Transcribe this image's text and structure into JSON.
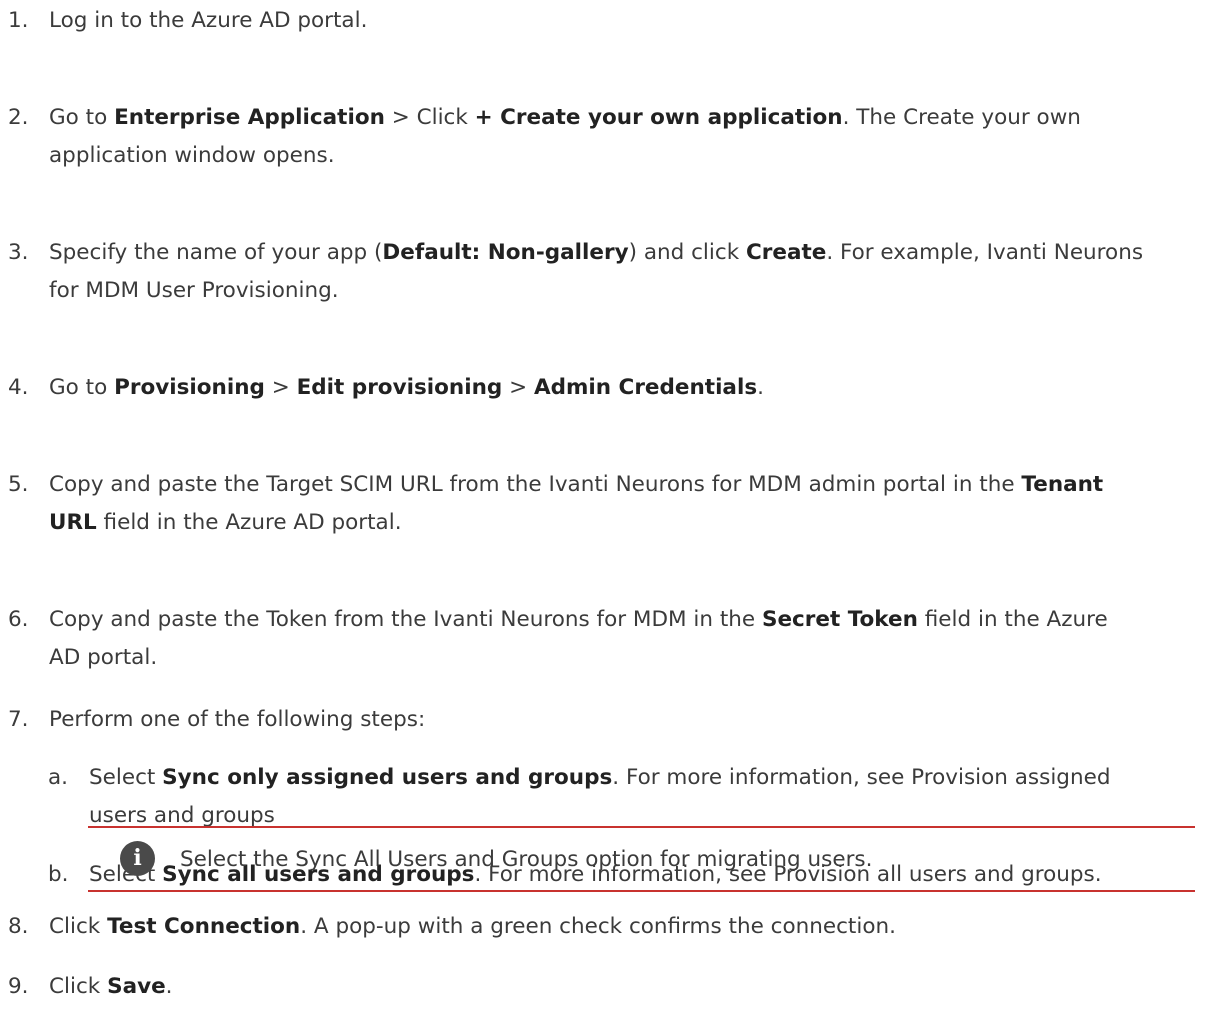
{
  "steps": [
    {
      "num": "1.",
      "text": "Log in to the Azure AD portal."
    },
    {
      "num": "2.",
      "t1": "Go to ",
      "b1": "Enterprise Application",
      "t2": " > Click ",
      "b2": "+ Create your own application",
      "t3": ". The Create your own",
      "line2": "application window opens."
    },
    {
      "num": "3.",
      "t1": "Specify the name of your app (",
      "b1": "Default: Non-gallery",
      "t2": ") and click ",
      "b2": "Create",
      "t3": ". For example, Ivanti Neurons",
      "line2": "for MDM User Provisioning."
    },
    {
      "num": "4.",
      "t1": "Go to ",
      "b1": "Provisioning",
      "t2": " > ",
      "b2": "Edit provisioning",
      "t3": " > ",
      "b3": "Admin Credentials",
      "t4": "."
    },
    {
      "num": "5.",
      "t1": "Copy and paste the Target SCIM URL from the Ivanti Neurons for MDM admin portal in the ",
      "b1": "Tenant",
      "b2": "URL",
      "t2": " field in the Azure AD portal."
    },
    {
      "num": "6.",
      "t1": "Copy and paste the Token from the Ivanti Neurons for MDM in the ",
      "b1": "Secret Token",
      "t2": " field in the Azure",
      "line2": "AD portal."
    },
    {
      "num": "7.",
      "text": "Perform one of the following steps:"
    },
    {
      "num": "8.",
      "t1": "Click ",
      "b1": "Test Connection",
      "t2": ". A pop-up with a green check confirms the connection."
    },
    {
      "num": "9.",
      "t1": "Click ",
      "b1": "Save",
      "t2": "."
    }
  ],
  "substeps": [
    {
      "num": "a.",
      "t1": "Select ",
      "b1": "Sync only assigned users and groups",
      "t2": ". For more information, see Provision assigned",
      "line2": "users and groups"
    },
    {
      "num": "b.",
      "t1": "Select ",
      "b1": "Sync all users and groups",
      "t2": ". For more information, see Provision all users and groups."
    }
  ],
  "note": {
    "icon": "info-icon",
    "icon_glyph": "i",
    "text": "Select the Sync All Users and Groups option for migrating users.",
    "border_color": "#c8322f"
  }
}
